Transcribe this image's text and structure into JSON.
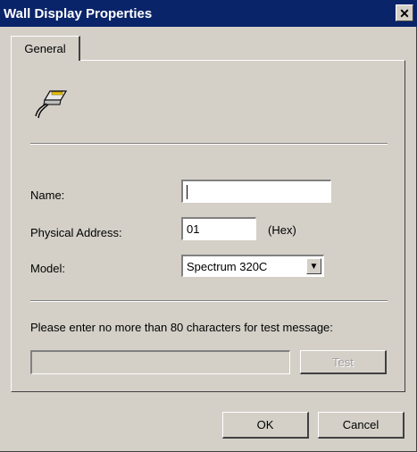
{
  "window": {
    "title": "Wall Display Properties",
    "close_symbol": "✕"
  },
  "tabs": [
    {
      "label": "General",
      "active": true
    }
  ],
  "icon": "wall-display-connector-icon",
  "form": {
    "name": {
      "label": "Name:",
      "value": ""
    },
    "physical_address": {
      "label": "Physical Address:",
      "value": "01",
      "suffix": "(Hex)"
    },
    "model": {
      "label": "Model:",
      "selected": "Spectrum 320C"
    }
  },
  "test_message": {
    "prompt": "Please enter no more than 80 characters for test message:",
    "value": "",
    "button_label": "Test"
  },
  "buttons": {
    "ok": "OK",
    "cancel": "Cancel"
  },
  "colors": {
    "title_bar": "#0a246a",
    "face": "#d4d0c8",
    "field": "#ffffff"
  }
}
